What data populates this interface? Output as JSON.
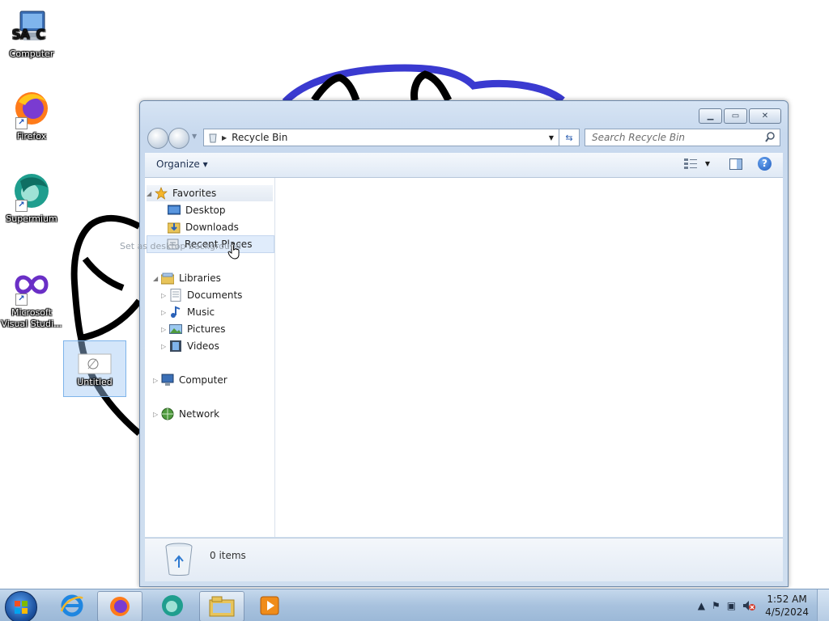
{
  "desktop": {
    "icons": [
      {
        "label": "Computer"
      },
      {
        "label": "Firefox"
      },
      {
        "label": "Supermium"
      },
      {
        "label": "Microsoft Visual Studi..."
      },
      {
        "label": "Untitled"
      }
    ],
    "drag_tooltip": "Set as desktop background"
  },
  "explorer": {
    "address": "Recycle Bin",
    "search_placeholder": "Search Recycle Bin",
    "organize_label": "Organize",
    "nav": {
      "favorites": "Favorites",
      "desktop": "Desktop",
      "downloads": "Downloads",
      "recent_places": "Recent Places",
      "libraries": "Libraries",
      "documents": "Documents",
      "music": "Music",
      "pictures": "Pictures",
      "videos": "Videos",
      "computer": "Computer",
      "network": "Network"
    },
    "status": "0 items"
  },
  "taskbar": {
    "time": "1:52 AM",
    "date": "4/5/2024"
  },
  "colors": {
    "window_frame": "#c8d9ee",
    "taskbar": "#a8c2de",
    "scribble_blue": "#3a3ad0",
    "scribble_black": "#000000"
  }
}
